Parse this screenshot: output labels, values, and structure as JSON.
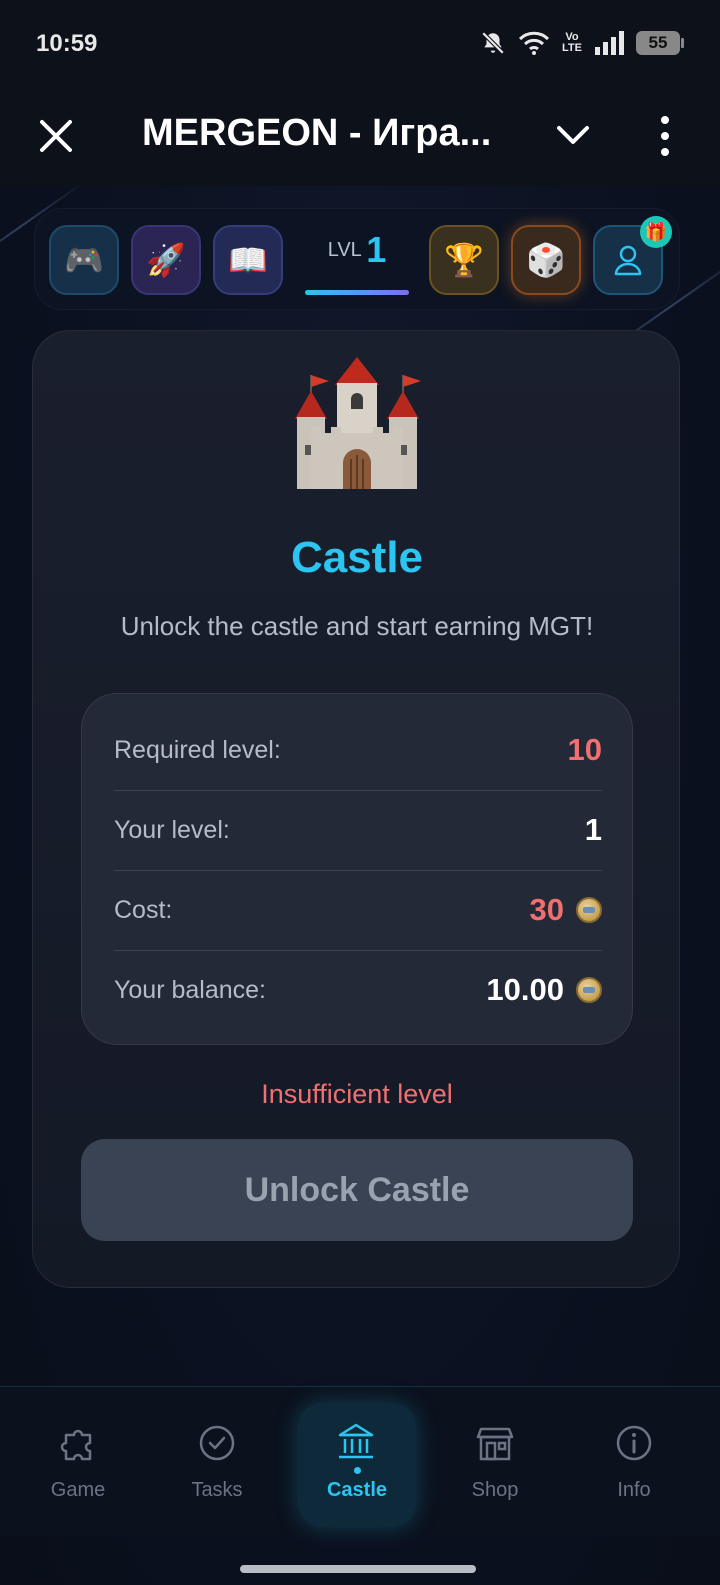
{
  "status_bar": {
    "time": "10:59",
    "battery": "55",
    "network_label_top": "Vo",
    "network_label_bottom": "LTE",
    "icons": [
      "bell-muted-icon",
      "wifi-icon",
      "volte-icon",
      "signal-icon",
      "battery-icon"
    ]
  },
  "title_bar": {
    "title": "MERGEON - Игра...",
    "icons": [
      "close-icon",
      "chevron-down-icon",
      "more-vertical-icon"
    ]
  },
  "top_nav": {
    "items": [
      {
        "name": "game",
        "glyph": "🎮"
      },
      {
        "name": "rocket",
        "glyph": "🚀"
      },
      {
        "name": "book",
        "glyph": "📖"
      },
      {
        "name": "trophy",
        "glyph": "🏆"
      },
      {
        "name": "dice",
        "glyph": "🎲"
      },
      {
        "name": "profile",
        "glyph": ""
      }
    ],
    "level_label": "LVL",
    "level_value": "1",
    "gift_glyph": "🎁"
  },
  "card": {
    "title": "Castle",
    "subtitle": "Unlock the castle and start earning MGT!",
    "rows": [
      {
        "label": "Required level:",
        "value": "10"
      },
      {
        "label": "Your level:",
        "value": "1"
      },
      {
        "label": "Cost:",
        "value": "30"
      },
      {
        "label": "Your balance:",
        "value": "10.00"
      }
    ],
    "warning": "Insufficient level",
    "unlock_button": "Unlock Castle"
  },
  "bottom_nav": {
    "items": [
      {
        "label": "Game",
        "icon": "puzzle-icon"
      },
      {
        "label": "Tasks",
        "icon": "check-circle-icon"
      },
      {
        "label": "Castle",
        "icon": "castle-icon",
        "active": true
      },
      {
        "label": "Shop",
        "icon": "store-icon"
      },
      {
        "label": "Info",
        "icon": "info-icon"
      }
    ]
  },
  "colors": {
    "accent": "#2cc4f0",
    "danger": "#f07070",
    "background": "#0b1120",
    "card": "#1a1f2d"
  }
}
